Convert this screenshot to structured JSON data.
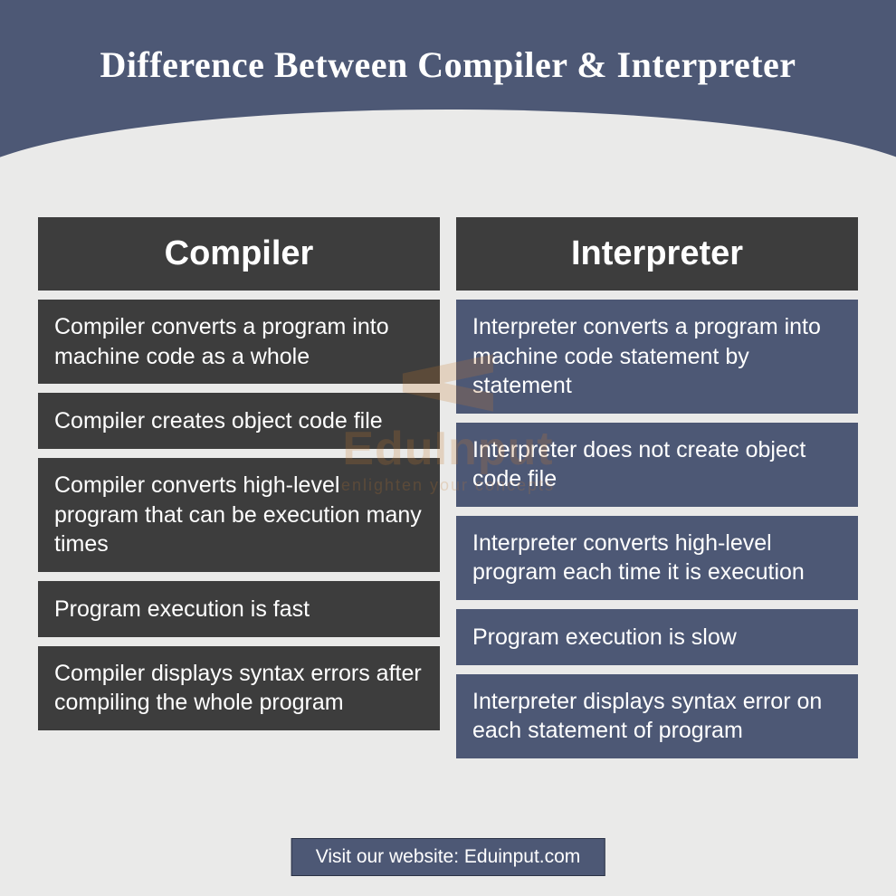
{
  "title": "Difference Between Compiler & Interpreter",
  "columns": {
    "left": {
      "header": "Compiler",
      "rows": [
        "Compiler converts a program into machine code as a whole",
        "Compiler creates object code file",
        "Compiler converts high-level program that can be execution many times",
        "Program execution is fast",
        "Compiler displays syntax errors after compiling the whole program"
      ]
    },
    "right": {
      "header": "Interpreter",
      "rows": [
        "Interpreter converts a program into machine code statement by statement",
        "Interpreter does not create object code file",
        "Interpreter converts high-level program each time it is execution",
        "Program execution is slow",
        "Interpreter displays syntax error on each statement of program"
      ]
    }
  },
  "watermark": {
    "text": "EduInput",
    "sub": "enlighten your concepts"
  },
  "footer": "Visit our website: Eduinput.com",
  "chart_data": {
    "type": "table",
    "title": "Difference Between Compiler & Interpreter",
    "columns": [
      "Compiler",
      "Interpreter"
    ],
    "rows": [
      [
        "Compiler converts a program into machine code as a whole",
        "Interpreter converts a program into machine code statement by statement"
      ],
      [
        "Compiler creates object code file",
        "Interpreter does not create object code file"
      ],
      [
        "Compiler converts high-level program that can be execution many times",
        "Interpreter converts high-level program each time it is execution"
      ],
      [
        "Program execution is fast",
        "Program execution is slow"
      ],
      [
        "Compiler displays syntax errors after compiling the whole program",
        "Interpreter displays syntax error on each statement of program"
      ]
    ]
  }
}
